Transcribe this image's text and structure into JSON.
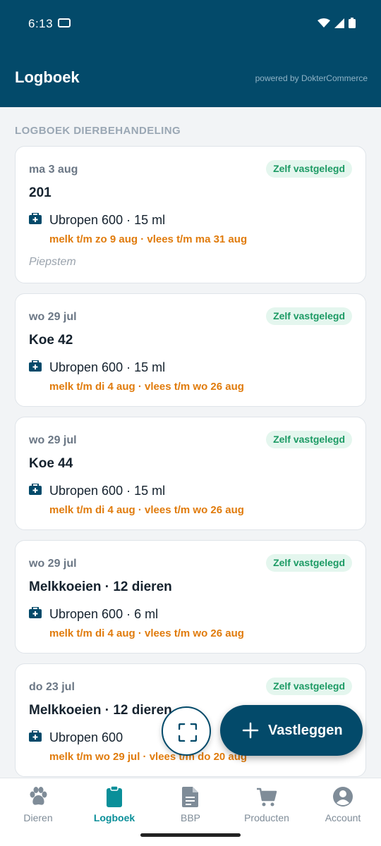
{
  "status_bar": {
    "time": "6:13"
  },
  "header": {
    "title": "Logboek",
    "powered_by": "powered by DokterCommerce"
  },
  "section_title": "LOGBOEK DIERBEHANDELING",
  "entries": [
    {
      "date": "ma 3 aug",
      "badge": "Zelf vastgelegd",
      "title": "201",
      "medication": "Ubropen 600  ·  15 ml",
      "waiting": "melk t/m zo 9 aug  ·  vlees t/m ma 31 aug",
      "note": "Piepstem"
    },
    {
      "date": "wo 29 jul",
      "badge": "Zelf vastgelegd",
      "title": "Koe 42",
      "medication": "Ubropen 600  ·  15 ml",
      "waiting": "melk t/m di 4 aug  ·  vlees t/m wo 26 aug"
    },
    {
      "date": "wo 29 jul",
      "badge": "Zelf vastgelegd",
      "title": "Koe 44",
      "medication": "Ubropen 600  ·  15 ml",
      "waiting": "melk t/m di 4 aug  ·  vlees t/m wo 26 aug"
    },
    {
      "date": "wo 29 jul",
      "badge": "Zelf vastgelegd",
      "title": "Melkkoeien · 12 dieren",
      "medication": "Ubropen 600  ·  6 ml",
      "waiting": "melk t/m di 4 aug  ·  vlees t/m wo 26 aug"
    },
    {
      "date": "do 23 jul",
      "badge": "Zelf vastgelegd",
      "title": "Melkkoeien · 12 dieren",
      "medication": "Ubropen 600",
      "waiting": "melk t/m wo 29 jul  ·  vlees t/m do 20 aug"
    }
  ],
  "fab": {
    "label": "Vastleggen"
  },
  "nav": [
    {
      "label": "Dieren",
      "icon": "paw-icon"
    },
    {
      "label": "Logboek",
      "icon": "clipboard-icon"
    },
    {
      "label": "BBP",
      "icon": "document-icon"
    },
    {
      "label": "Producten",
      "icon": "cart-icon"
    },
    {
      "label": "Account",
      "icon": "account-icon"
    }
  ],
  "colors": {
    "primary": "#034a6a",
    "accent": "#0a8f99",
    "badge_text": "#1c9a64",
    "warning": "#e07b0c"
  }
}
